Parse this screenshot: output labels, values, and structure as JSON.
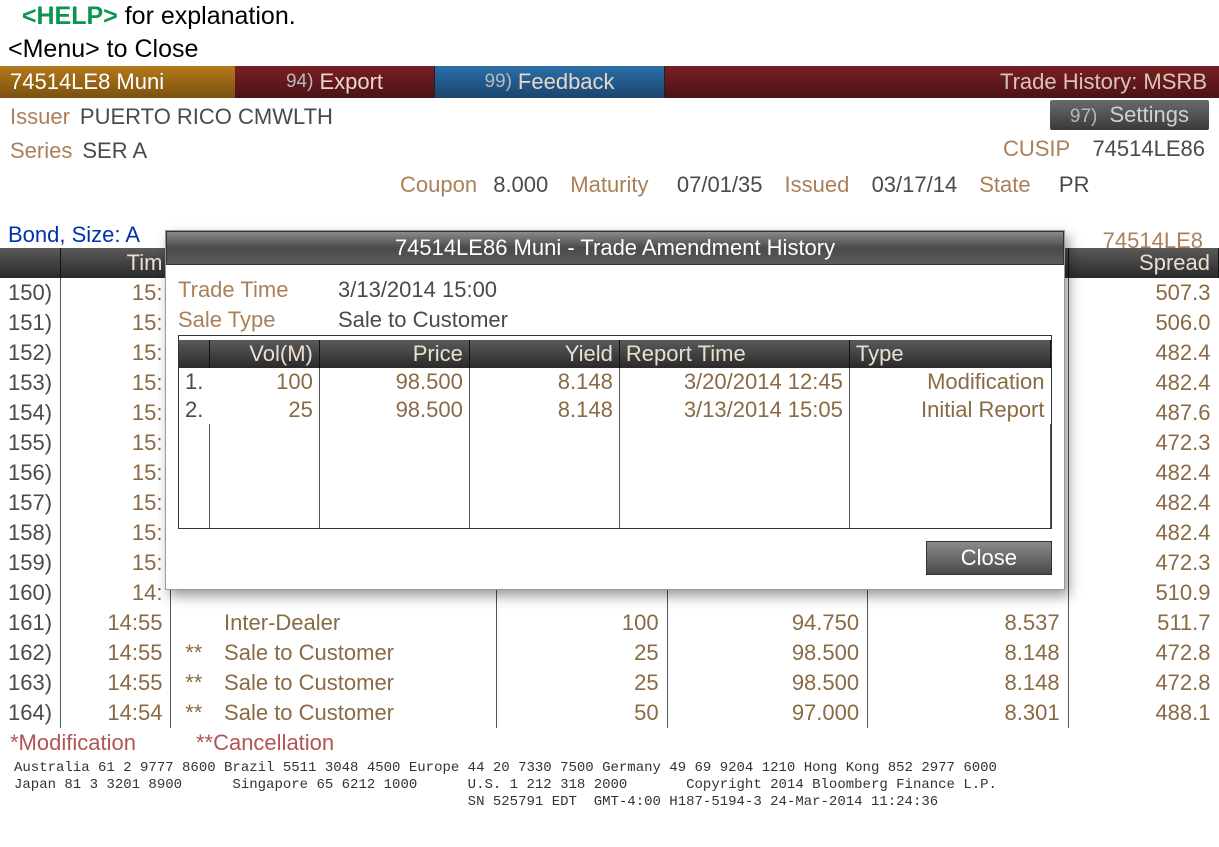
{
  "hints": {
    "help_key": "<HELP>",
    "help_text": " for explanation.",
    "menu_text": "<Menu> to Close"
  },
  "titlebar": {
    "cusip_muni": "74514LE8 Muni",
    "export_num": "94)",
    "export_label": "Export",
    "feedback_num": "99)",
    "feedback_label": "Feedback",
    "right_label": "Trade History: MSRB"
  },
  "header": {
    "issuer_label": "Issuer",
    "issuer_value": "PUERTO RICO CMWLTH",
    "series_label": "Series",
    "series_value": "SER A",
    "settings_num": "97)",
    "settings_label": "Settings",
    "cusip_label": "CUSIP",
    "cusip_value": "74514LE86",
    "coupon_label": "Coupon",
    "coupon_value": "8.000",
    "maturity_label": "Maturity",
    "maturity_value": "07/01/35",
    "issued_label": "Issued",
    "issued_value": "03/17/14",
    "state_label": "State",
    "state_value": "PR"
  },
  "bond_size_label": "Bond, Size: A",
  "right_small_cusip": "74514LE8",
  "table": {
    "columns": {
      "idx": "",
      "time": "Tim",
      "mark": "",
      "type": "",
      "size": "",
      "price": "",
      "yield": "",
      "spread": "Spread"
    },
    "rows": [
      {
        "idx": "150)",
        "time": "15:",
        "mark": "",
        "type": "",
        "size": "",
        "price": "",
        "yield": "",
        "spread": "507.3"
      },
      {
        "idx": "151)",
        "time": "15:",
        "mark": "",
        "type": "",
        "size": "",
        "price": "",
        "yield": "",
        "spread": "506.0"
      },
      {
        "idx": "152)",
        "time": "15:",
        "mark": "",
        "type": "",
        "size": "",
        "price": "",
        "yield": "",
        "spread": "482.4"
      },
      {
        "idx": "153)",
        "time": "15:",
        "mark": "",
        "type": "",
        "size": "",
        "price": "",
        "yield": "",
        "spread": "482.4"
      },
      {
        "idx": "154)",
        "time": "15:",
        "mark": "",
        "type": "",
        "size": "",
        "price": "",
        "yield": "",
        "spread": "487.6"
      },
      {
        "idx": "155)",
        "time": "15:",
        "mark": "",
        "type": "",
        "size": "",
        "price": "",
        "yield": "",
        "spread": "472.3"
      },
      {
        "idx": "156)",
        "time": "15:",
        "mark": "",
        "type": "",
        "size": "",
        "price": "",
        "yield": "",
        "spread": "482.4"
      },
      {
        "idx": "157)",
        "time": "15:",
        "mark": "",
        "type": "",
        "size": "",
        "price": "",
        "yield": "",
        "spread": "482.4"
      },
      {
        "idx": "158)",
        "time": "15:",
        "mark": "",
        "type": "",
        "size": "",
        "price": "",
        "yield": "",
        "spread": "482.4"
      },
      {
        "idx": "159)",
        "time": "15:",
        "mark": "",
        "type": "",
        "size": "",
        "price": "",
        "yield": "",
        "spread": "472.3"
      },
      {
        "idx": "160)",
        "time": "14:",
        "mark": "",
        "type": "",
        "size": "",
        "price": "",
        "yield": "",
        "spread": "510.9"
      },
      {
        "idx": "161)",
        "time": "14:55",
        "mark": "",
        "type": "Inter-Dealer",
        "size": "100",
        "price": "94.750",
        "yield": "8.537",
        "spread": "511.7"
      },
      {
        "idx": "162)",
        "time": "14:55",
        "mark": "**",
        "type": "Sale to Customer",
        "size": "25",
        "price": "98.500",
        "yield": "8.148",
        "spread": "472.8"
      },
      {
        "idx": "163)",
        "time": "14:55",
        "mark": "**",
        "type": "Sale to Customer",
        "size": "25",
        "price": "98.500",
        "yield": "8.148",
        "spread": "472.8"
      },
      {
        "idx": "164)",
        "time": "14:54",
        "mark": "**",
        "type": "Sale to Customer",
        "size": "50",
        "price": "97.000",
        "yield": "8.301",
        "spread": "488.1"
      }
    ]
  },
  "legend": {
    "modification": "*Modification",
    "cancellation": "**Cancellation"
  },
  "footer": {
    "line1": "Australia 61 2 9777 8600 Brazil 5511 3048 4500 Europe 44 20 7330 7500 Germany 49 69 9204 1210 Hong Kong 852 2977 6000",
    "line2": "Japan 81 3 3201 8900      Singapore 65 6212 1000      U.S. 1 212 318 2000       Copyright 2014 Bloomberg Finance L.P.",
    "line3": "                                                      SN 525791 EDT  GMT-4:00 H187-5194-3 24-Mar-2014 11:24:36"
  },
  "popup": {
    "title": "74514LE86 Muni - Trade Amendment History",
    "trade_time_label": "Trade Time",
    "trade_time_value": "3/13/2014 15:00",
    "sale_type_label": "Sale Type",
    "sale_type_value": "Sale to Customer",
    "columns": {
      "idx": "",
      "vol": "Vol(M)",
      "price": "Price",
      "yield": "Yield",
      "report_time": "Report Time",
      "type": "Type"
    },
    "rows": [
      {
        "idx": "1.",
        "vol": "100",
        "price": "98.500",
        "yield": "8.148",
        "report_time": "3/20/2014 12:45",
        "type": "Modification"
      },
      {
        "idx": "2.",
        "vol": "25",
        "price": "98.500",
        "yield": "8.148",
        "report_time": "3/13/2014 15:05",
        "type": "Initial Report"
      }
    ],
    "close_label": "Close"
  }
}
